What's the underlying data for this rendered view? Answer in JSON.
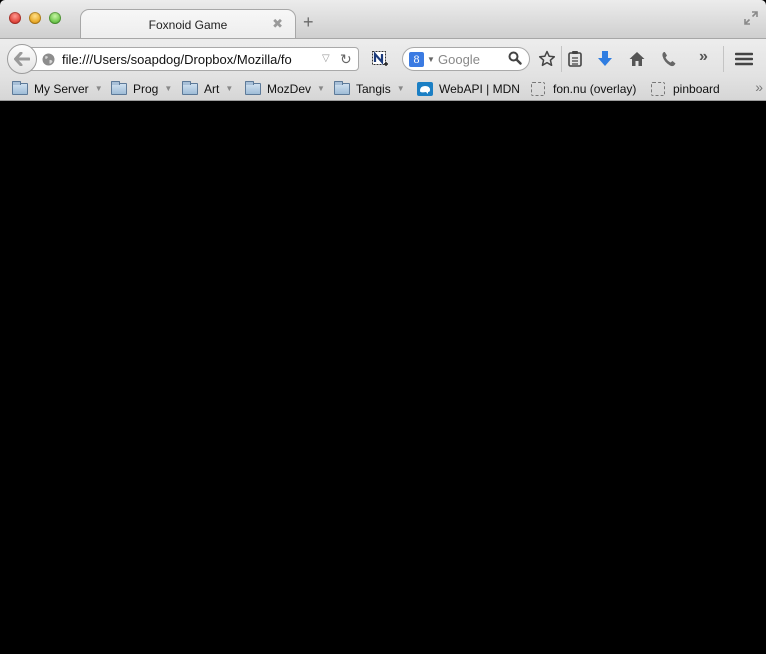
{
  "window": {
    "controls": [
      "close",
      "minimize",
      "zoom"
    ],
    "fullscreen_icon": "fullscreen-arrows-icon"
  },
  "tabs": [
    {
      "title": "Foxnoid Game",
      "active": true,
      "close_icon": "close-icon",
      "close_glyph": "✖"
    }
  ],
  "new_tab": {
    "glyph": "+"
  },
  "navbar": {
    "back_icon": "back-arrow-icon",
    "url": "file:///Users/soapdog/Dropbox/Mozilla/fo",
    "url_dropdown_glyph": "▽",
    "reload_glyph": "↻",
    "extension_icon": "evernote-clipper-icon",
    "search": {
      "engine": "Google",
      "engine_glyph": "8",
      "placeholder": "Google",
      "value": ""
    },
    "icons": [
      "bookmark-star-icon",
      "reading-list-icon",
      "downloads-icon",
      "home-icon",
      "phone-icon"
    ],
    "overflow_glyph": "»",
    "menu_icon": "hamburger-menu-icon",
    "accent_color": "#2f7de1"
  },
  "bookmarks": {
    "items": [
      {
        "label": "My Server",
        "type": "folder"
      },
      {
        "label": "Prog",
        "type": "folder"
      },
      {
        "label": "Art",
        "type": "folder"
      },
      {
        "label": "MozDev",
        "type": "folder"
      },
      {
        "label": "Tangis",
        "type": "folder"
      },
      {
        "label": "WebAPI | MDN",
        "type": "link",
        "icon": "mdn-icon"
      },
      {
        "label": "fon.nu (overlay)",
        "type": "bookmarklet"
      },
      {
        "label": "pinboard",
        "type": "bookmarklet"
      }
    ],
    "dropdown_glyph": "▼",
    "overflow_glyph": "»"
  },
  "content": {
    "background": "#000000"
  }
}
